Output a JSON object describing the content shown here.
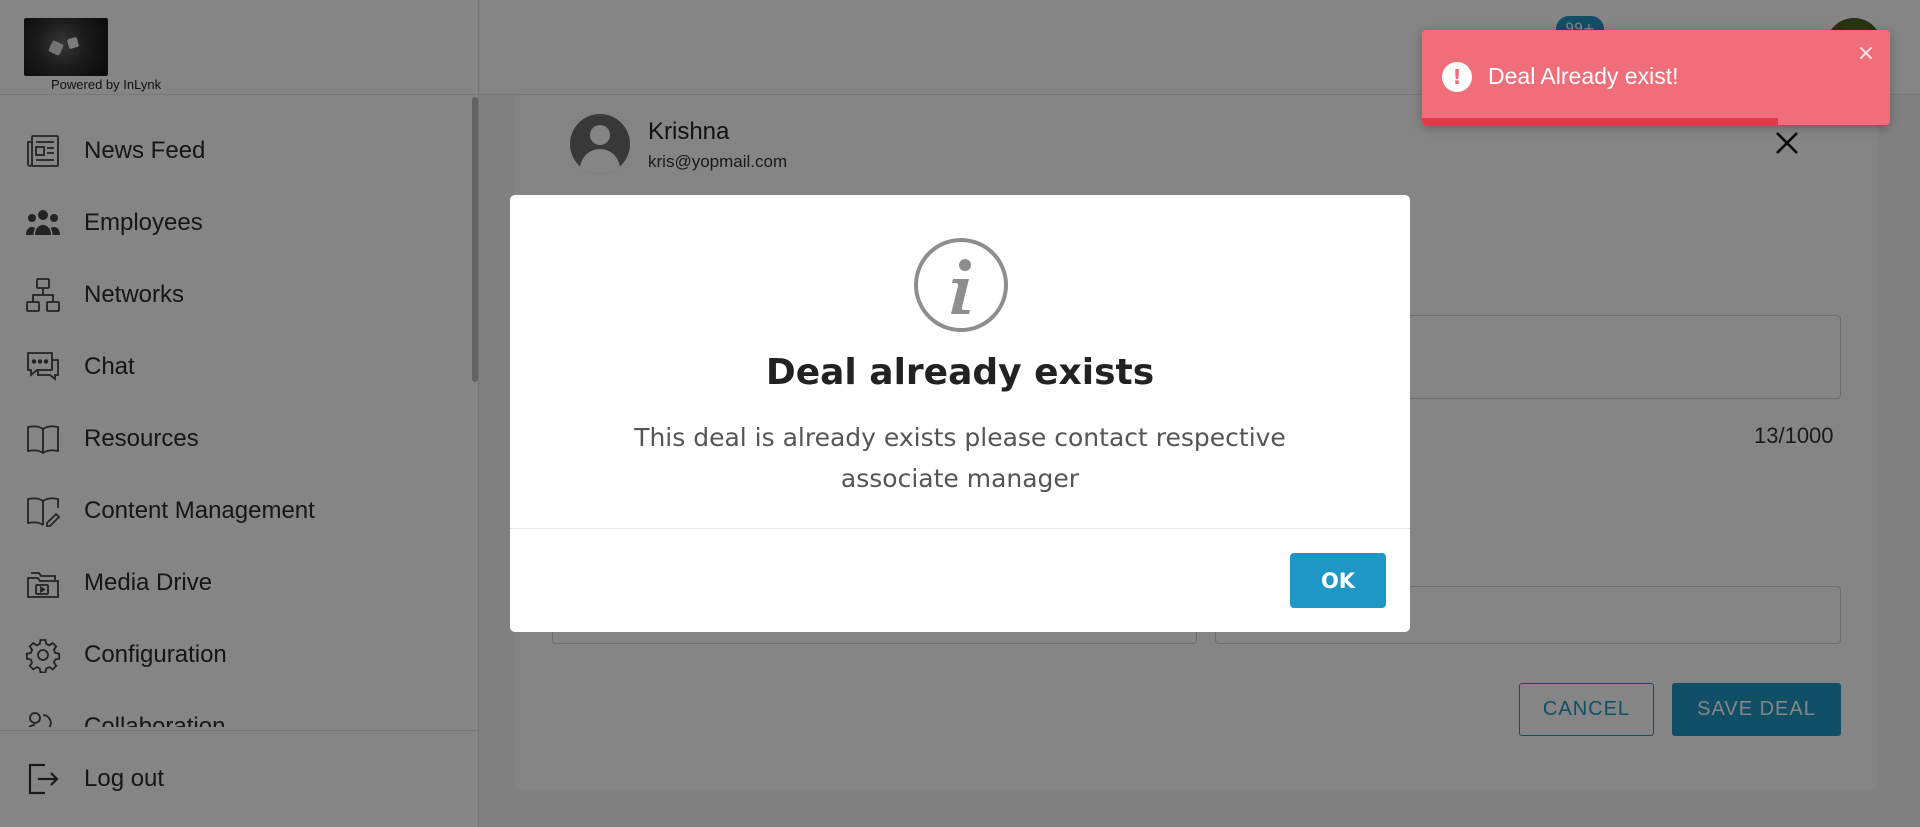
{
  "app": {
    "powered_by": "Powered by InLynk"
  },
  "sidebar": {
    "items": [
      {
        "label": "News Feed",
        "icon": "newspaper-icon"
      },
      {
        "label": "Employees",
        "icon": "people-icon"
      },
      {
        "label": "Networks",
        "icon": "network-icon"
      },
      {
        "label": "Chat",
        "icon": "chat-icon"
      },
      {
        "label": "Resources",
        "icon": "book-icon"
      },
      {
        "label": "Content Management",
        "icon": "book-edit-icon"
      },
      {
        "label": "Media Drive",
        "icon": "folder-media-icon"
      },
      {
        "label": "Configuration",
        "icon": "gear-icon"
      },
      {
        "label": "Collaboration",
        "icon": "collaboration-icon"
      }
    ],
    "logout_label": "Log out"
  },
  "header": {
    "notification_badge": "99+"
  },
  "deal_form": {
    "assignee_name": "Krishna",
    "assignee_email": "kris@yopmail.com",
    "char_counter": "13/1000",
    "cancel_label": "CANCEL",
    "save_label": "SAVE DEAL"
  },
  "modal": {
    "icon": "info-icon",
    "title": "Deal already exists",
    "message": "This deal is already exists please contact respective associate manager",
    "ok_label": "OK"
  },
  "toast": {
    "message": "Deal Already exist!",
    "icon": "exclamation-icon",
    "close_glyph": "×",
    "color": "#f06e7a",
    "progress_remaining": 0.76
  },
  "colors": {
    "accent": "#1f97c4",
    "toast_bg": "#f06e7a"
  }
}
